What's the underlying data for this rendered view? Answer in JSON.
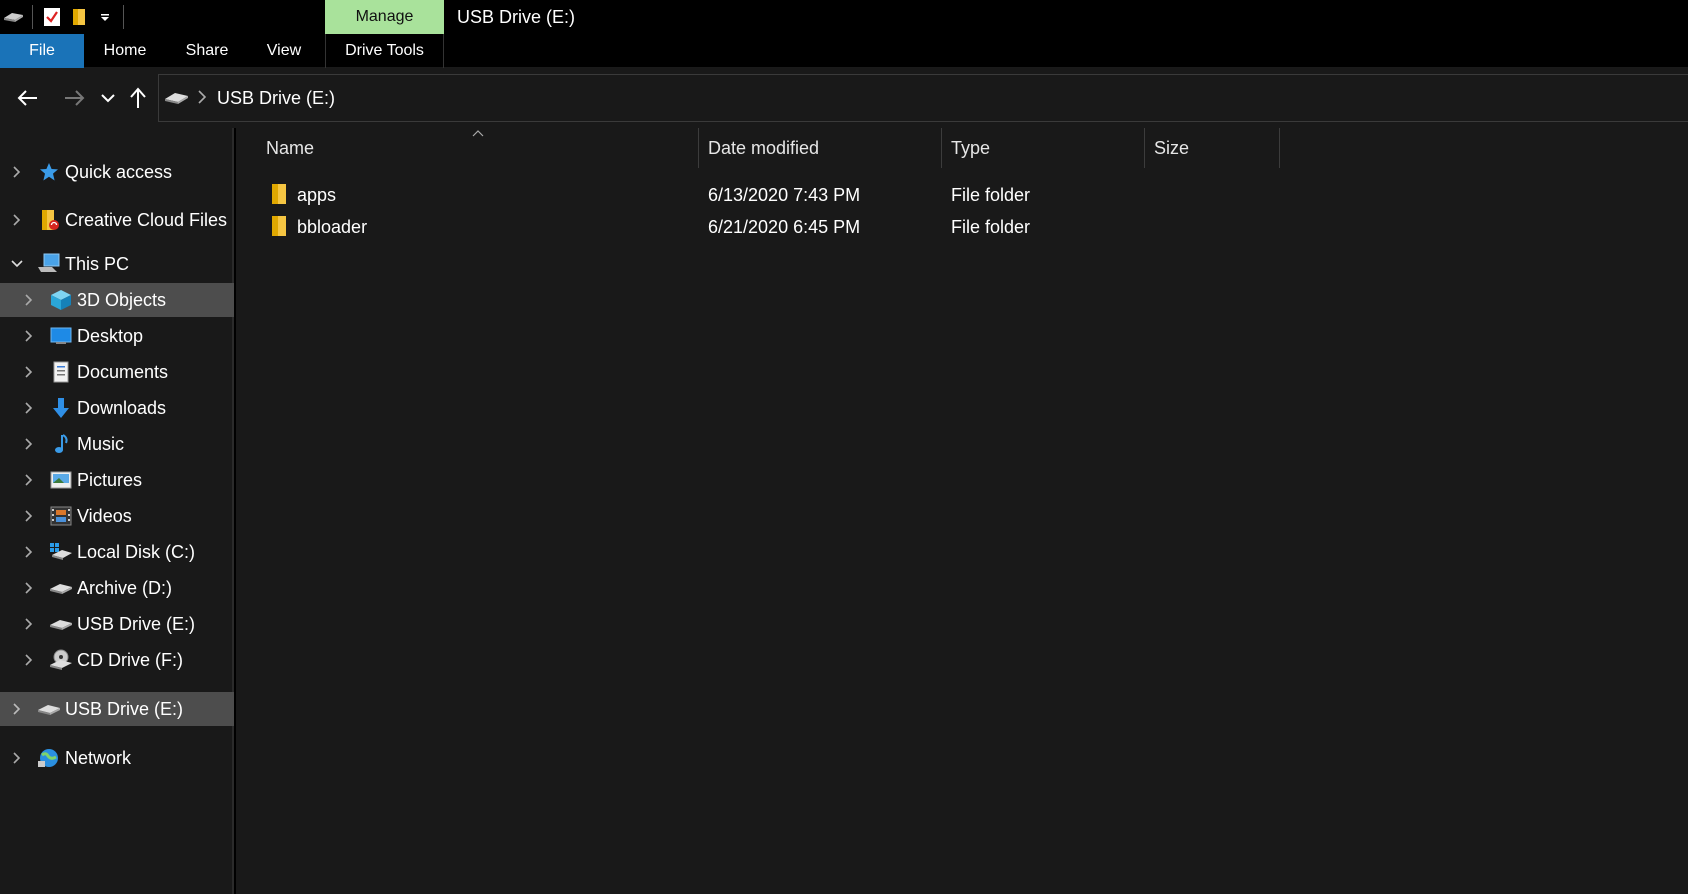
{
  "window": {
    "title": "USB Drive (E:)",
    "contextual_tab": "Manage"
  },
  "quick_access_toolbar": {
    "icons": [
      "drive-icon",
      "properties-icon",
      "new-folder-icon",
      "customize-dropdown-icon"
    ]
  },
  "ribbon": {
    "tabs": [
      {
        "label": "File"
      },
      {
        "label": "Home"
      },
      {
        "label": "Share"
      },
      {
        "label": "View"
      },
      {
        "label": "Drive Tools"
      }
    ]
  },
  "address": {
    "path": "USB Drive (E:)"
  },
  "nav_pane": {
    "items": [
      {
        "label": "Quick access",
        "icon": "star-icon"
      },
      {
        "label": "Creative Cloud Files",
        "icon": "creative-cloud-folder-icon"
      },
      {
        "label": "This PC",
        "icon": "computer-icon"
      },
      {
        "label": "3D Objects",
        "icon": "cube-icon"
      },
      {
        "label": "Desktop",
        "icon": "desktop-icon"
      },
      {
        "label": "Documents",
        "icon": "document-icon"
      },
      {
        "label": "Downloads",
        "icon": "download-arrow-icon"
      },
      {
        "label": "Music",
        "icon": "music-note-icon"
      },
      {
        "label": "Pictures",
        "icon": "picture-icon"
      },
      {
        "label": "Videos",
        "icon": "film-icon"
      },
      {
        "label": "Local Disk (C:)",
        "icon": "windows-drive-icon"
      },
      {
        "label": "Archive (D:)",
        "icon": "drive-icon"
      },
      {
        "label": "USB Drive (E:)",
        "icon": "drive-icon"
      },
      {
        "label": "CD Drive (F:)",
        "icon": "cd-drive-icon"
      },
      {
        "label": "USB Drive (E:)",
        "icon": "drive-icon"
      },
      {
        "label": "Network",
        "icon": "network-icon"
      }
    ]
  },
  "file_list": {
    "columns": [
      "Name",
      "Date modified",
      "Type",
      "Size"
    ],
    "rows": [
      {
        "name": "apps",
        "date": "6/13/2020 7:43 PM",
        "type": "File folder",
        "size": ""
      },
      {
        "name": "bbloader",
        "date": "6/21/2020 6:45 PM",
        "type": "File folder",
        "size": ""
      }
    ]
  },
  "colors": {
    "file_tab": "#1a73b8",
    "manage_tab": "#a9e29b",
    "selected_item": "#4d4d4d",
    "background": "#191919"
  }
}
